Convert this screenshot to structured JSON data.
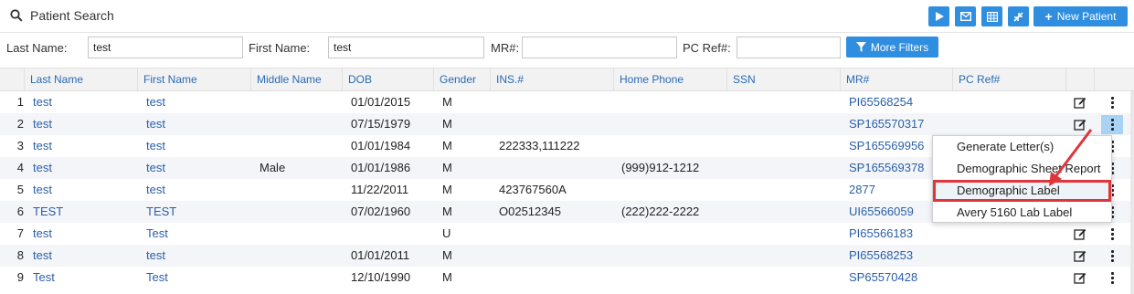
{
  "header": {
    "title": "Patient Search",
    "new_patient_label": "New Patient",
    "toolbar_icons": [
      "play-icon",
      "envelope-icon",
      "grid-icon",
      "compress-icon"
    ]
  },
  "filters": {
    "last_name_label": "Last Name:",
    "last_name_value": "test",
    "first_name_label": "First Name:",
    "first_name_value": "test",
    "mr_label": "MR#:",
    "mr_value": "",
    "pc_ref_label": "PC Ref#:",
    "pc_ref_value": "",
    "more_filters_label": "More Filters"
  },
  "table": {
    "columns": {
      "last_name": "Last Name",
      "first_name": "First Name",
      "middle_name": "Middle Name",
      "dob": "DOB",
      "gender": "Gender",
      "ins": "INS.#",
      "home_phone": "Home Phone",
      "ssn": "SSN",
      "mr": "MR#",
      "pc_ref": "PC Ref#"
    },
    "rows": [
      {
        "num": "1",
        "last": "test",
        "first": "test",
        "middle": "",
        "dob": "01/01/2015",
        "gender": "M",
        "ins": "",
        "phone": "",
        "ssn": "",
        "mr": "PI65568254",
        "pcref": ""
      },
      {
        "num": "2",
        "last": "test",
        "first": "test",
        "middle": "",
        "dob": "07/15/1979",
        "gender": "M",
        "ins": "",
        "phone": "",
        "ssn": "",
        "mr": "SP165570317",
        "pcref": ""
      },
      {
        "num": "3",
        "last": "test",
        "first": "test",
        "middle": "",
        "dob": "01/01/1984",
        "gender": "M",
        "ins": "222333,111222",
        "phone": "",
        "ssn": "",
        "mr": "SP165569956",
        "pcref": ""
      },
      {
        "num": "4",
        "last": "test",
        "first": "test",
        "middle": "Male",
        "dob": "01/01/1986",
        "gender": "M",
        "ins": "",
        "phone": "(999)912-1212",
        "ssn": "",
        "mr": "SP165569378",
        "pcref": ""
      },
      {
        "num": "5",
        "last": "test",
        "first": "test",
        "middle": "",
        "dob": "11/22/2011",
        "gender": "M",
        "ins": "423767560A",
        "phone": "",
        "ssn": "",
        "mr": "2877",
        "pcref": ""
      },
      {
        "num": "6",
        "last": "TEST",
        "first": "TEST",
        "middle": "",
        "dob": "07/02/1960",
        "gender": "M",
        "ins": "O02512345",
        "phone": "(222)222-2222",
        "ssn": "",
        "mr": "UI65566059",
        "pcref": ""
      },
      {
        "num": "7",
        "last": "test",
        "first": "Test",
        "middle": "",
        "dob": "",
        "gender": "U",
        "ins": "",
        "phone": "",
        "ssn": "",
        "mr": "PI65566183",
        "pcref": ""
      },
      {
        "num": "8",
        "last": "test",
        "first": "test",
        "middle": "",
        "dob": "01/01/2011",
        "gender": "M",
        "ins": "",
        "phone": "",
        "ssn": "",
        "mr": "PI65568253",
        "pcref": ""
      },
      {
        "num": "9",
        "last": "Test",
        "first": "Test",
        "middle": "",
        "dob": "12/10/1990",
        "gender": "M",
        "ins": "",
        "phone": "",
        "ssn": "",
        "mr": "SP65570428",
        "pcref": ""
      }
    ]
  },
  "menu": {
    "items": [
      "Generate Letter(s)",
      "Demographic Sheet Report",
      "Demographic Label",
      "Avery 5160 Lab Label"
    ],
    "highlighted": "Demographic Label"
  },
  "colors": {
    "accent": "#2f8ee0",
    "link": "#2a5fa8",
    "highlight_box": "#e0353b",
    "active_row_action": "#a9d3f5"
  }
}
